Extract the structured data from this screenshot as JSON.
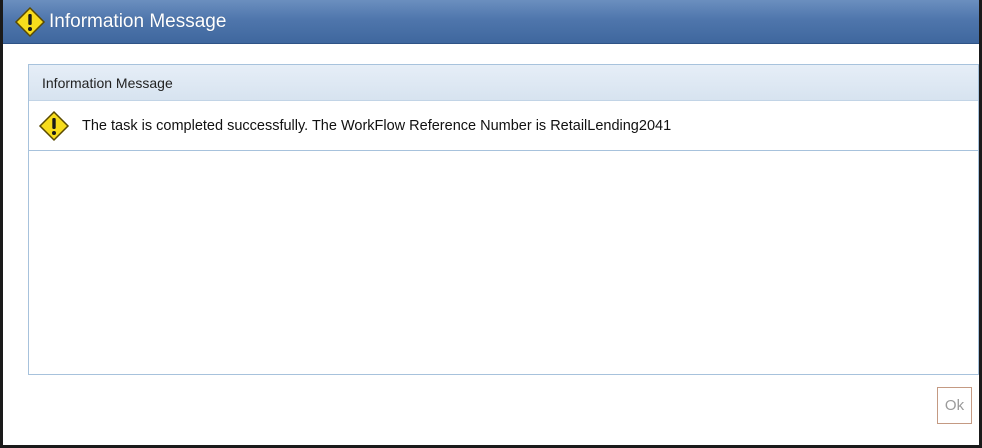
{
  "window": {
    "title": "Information Message",
    "title_icon": "warning-diamond-icon"
  },
  "panel": {
    "header": "Information Message",
    "message_icon": "warning-diamond-icon",
    "message": "The task is completed successfully. The WorkFlow Reference Number is RetailLending2041"
  },
  "buttons": {
    "ok_label": "Ok"
  },
  "colors": {
    "titlebar": "#4f76ac",
    "panel_border": "#a7c2dc",
    "warning_fill": "#f7dc1c"
  }
}
